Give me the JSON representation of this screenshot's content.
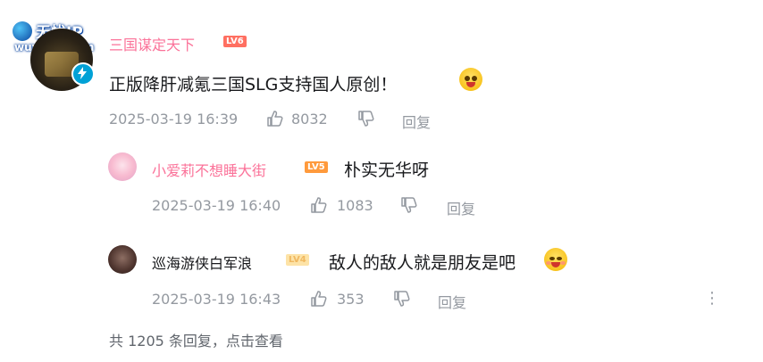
{
  "watermark": {
    "title": "无忧IP",
    "url": "wuyoudl.com"
  },
  "comment": {
    "username": "三国谋定天下",
    "level": "LV6",
    "text": "正版降肝减氪三国SLG支持国人原创！",
    "time": "2025-03-19 16:39",
    "likes": "8032",
    "reply_label": "回复",
    "emoji_icon": "crying-face-emoji"
  },
  "replies": [
    {
      "username": "小爱莉不想睡大街",
      "level": "LV5",
      "text": "朴实无华呀",
      "time": "2025-03-19 16:40",
      "likes": "1083",
      "reply_label": "回复"
    },
    {
      "username": "巡海游侠白军浪",
      "level": "LV4",
      "text": "敌人的敌人就是朋友是吧",
      "time": "2025-03-19 16:43",
      "likes": "353",
      "reply_label": "回复",
      "emoji_icon": "grinning-face-emoji"
    }
  ],
  "footer": {
    "summary": "共 1205 条回复，点击查看"
  },
  "colors": {
    "username_pink": "#fb7299",
    "meta_gray": "#9499a0",
    "text_dark": "#18191c",
    "lv6": "#ff6f61",
    "lv5": "#ff9a3c",
    "lv4": "#fde3a7"
  }
}
